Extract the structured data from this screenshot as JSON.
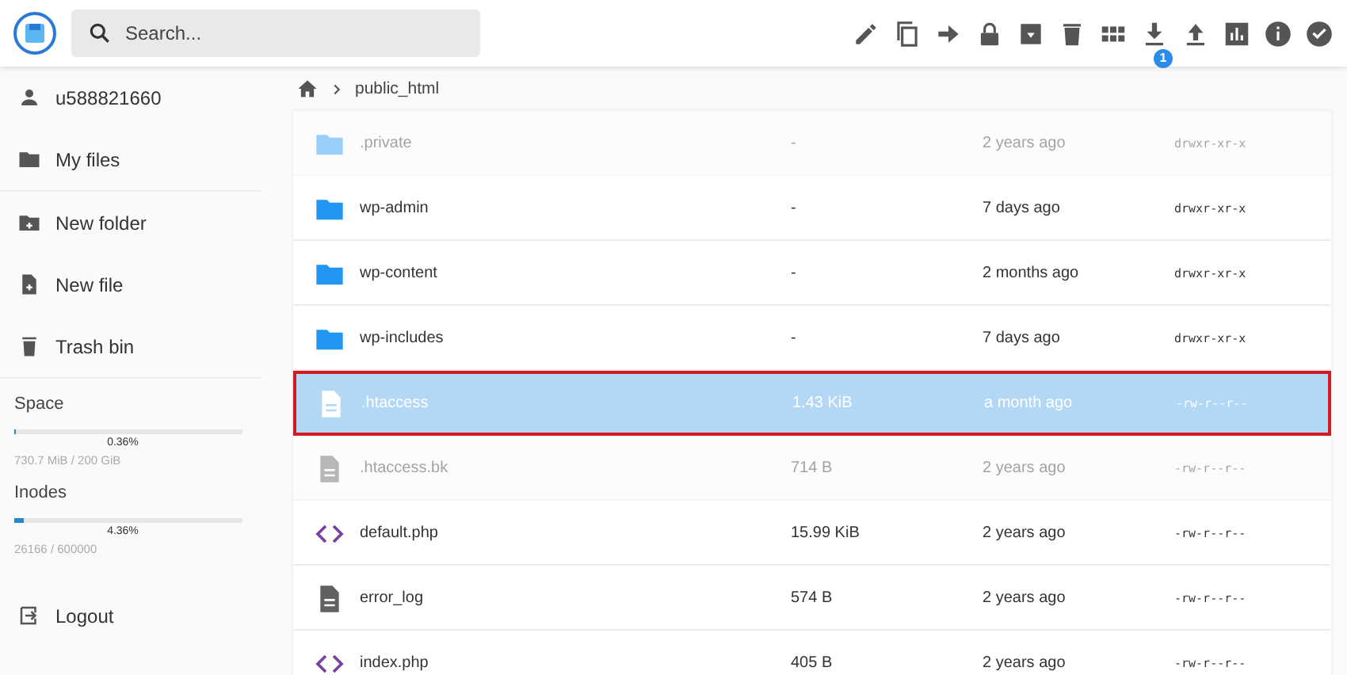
{
  "search": {
    "placeholder": "Search..."
  },
  "toolbar": {
    "download_badge": "1"
  },
  "sidebar": {
    "user": "u588821660",
    "items": [
      {
        "label": "My files"
      },
      {
        "label": "New folder"
      },
      {
        "label": "New file"
      },
      {
        "label": "Trash bin"
      }
    ],
    "usage": [
      {
        "title": "Space",
        "level": 0.0036,
        "percent": "0.36%",
        "detail": "730.7 MiB / 200 GiB"
      },
      {
        "title": "Inodes",
        "level": 0.0436,
        "percent": "4.36%",
        "detail": "26166 / 600000"
      }
    ],
    "logout": "Logout"
  },
  "breadcrumb": [
    "public_html"
  ],
  "files": [
    {
      "kind": "folder",
      "name": ".private",
      "size": "-",
      "modified": "2 years ago",
      "permissions": "drwxr-xr-x",
      "hidden": true,
      "selected": false,
      "highlighted": false
    },
    {
      "kind": "folder",
      "name": "wp-admin",
      "size": "-",
      "modified": "7 days ago",
      "permissions": "drwxr-xr-x",
      "hidden": false,
      "selected": false,
      "highlighted": false
    },
    {
      "kind": "folder",
      "name": "wp-content",
      "size": "-",
      "modified": "2 months ago",
      "permissions": "drwxr-xr-x",
      "hidden": false,
      "selected": false,
      "highlighted": false
    },
    {
      "kind": "folder",
      "name": "wp-includes",
      "size": "-",
      "modified": "7 days ago",
      "permissions": "drwxr-xr-x",
      "hidden": false,
      "selected": false,
      "highlighted": false
    },
    {
      "kind": "file",
      "name": ".htaccess",
      "size": "1.43 KiB",
      "modified": "a month ago",
      "permissions": "-rw-r--r--",
      "hidden": false,
      "selected": true,
      "highlighted": true
    },
    {
      "kind": "file",
      "name": ".htaccess.bk",
      "size": "714 B",
      "modified": "2 years ago",
      "permissions": "-rw-r--r--",
      "hidden": true,
      "selected": false,
      "highlighted": false
    },
    {
      "kind": "code",
      "name": "default.php",
      "size": "15.99 KiB",
      "modified": "2 years ago",
      "permissions": "-rw-r--r--",
      "hidden": false,
      "selected": false,
      "highlighted": false
    },
    {
      "kind": "file",
      "name": "error_log",
      "size": "574 B",
      "modified": "2 years ago",
      "permissions": "-rw-r--r--",
      "hidden": false,
      "selected": false,
      "highlighted": false
    },
    {
      "kind": "code",
      "name": "index.php",
      "size": "405 B",
      "modified": "2 years ago",
      "permissions": "-rw-r--r--",
      "hidden": false,
      "selected": false,
      "highlighted": false
    }
  ]
}
